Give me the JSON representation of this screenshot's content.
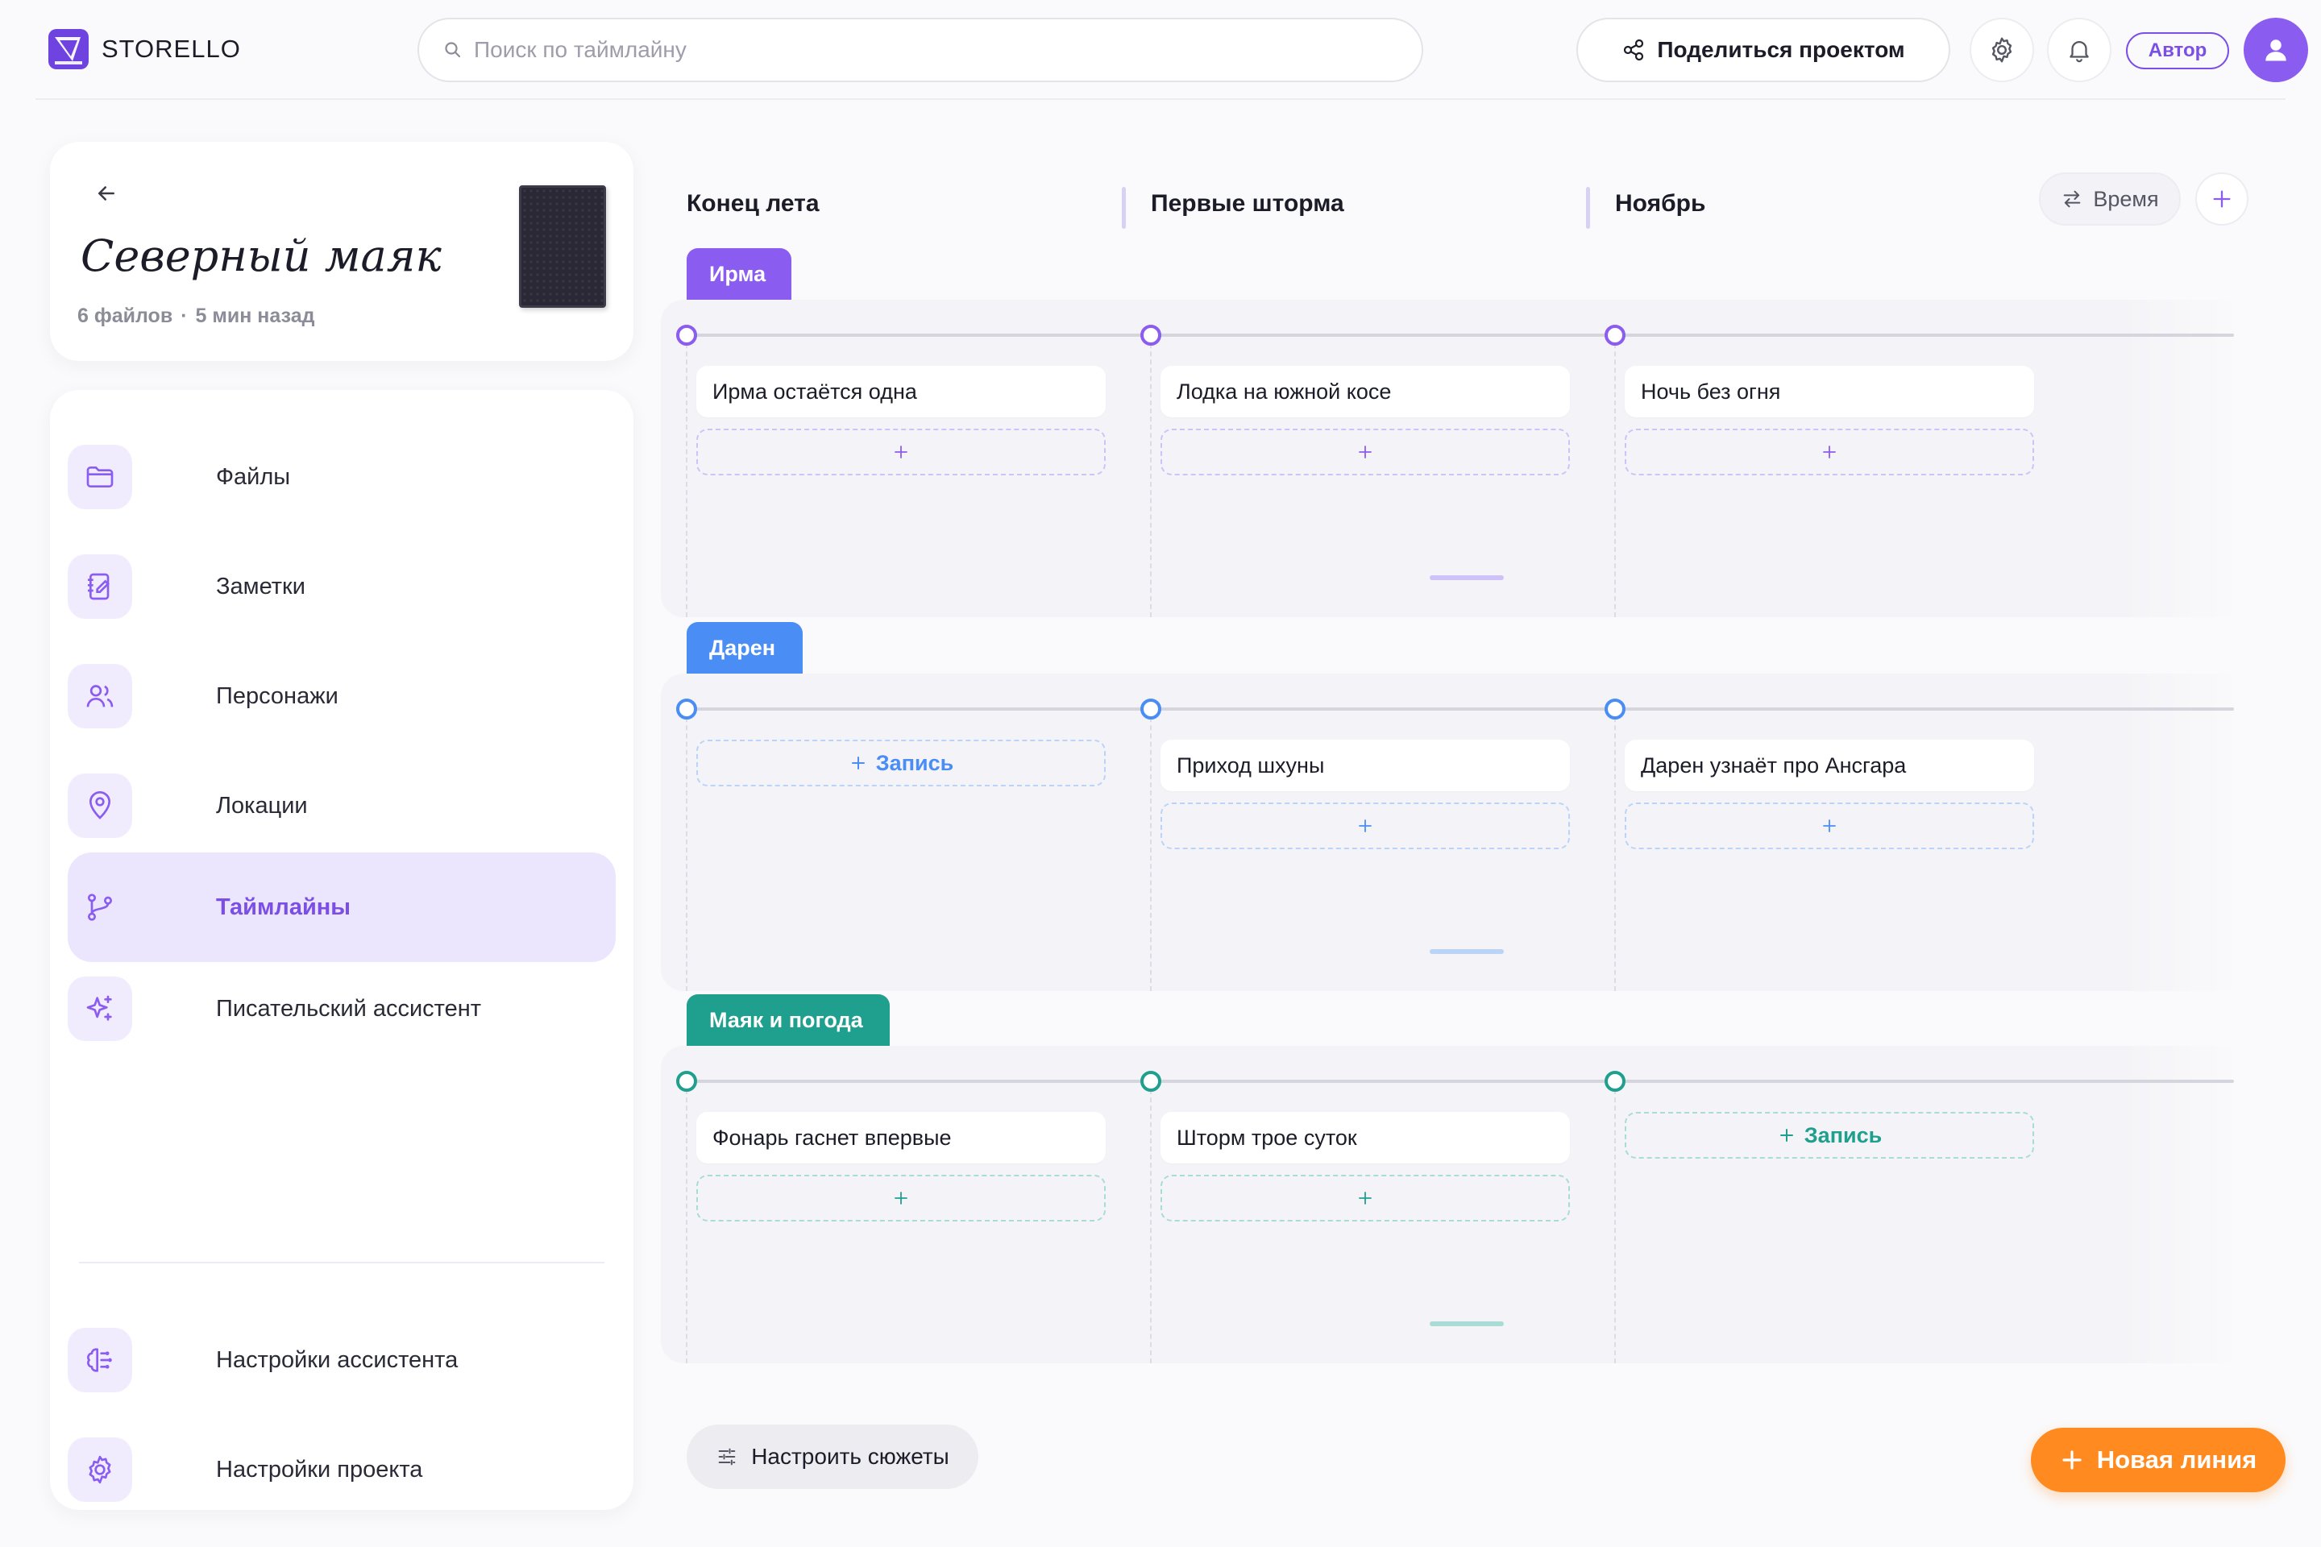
{
  "header": {
    "brand": "STORELLO",
    "search_placeholder": "Поиск по таймлайну",
    "share_label": "Поделиться проектом",
    "role_badge": "Автор"
  },
  "project": {
    "title": "Северный маяк",
    "files": "6 файлов",
    "separator": "·",
    "updated": "5 мин назад"
  },
  "nav": {
    "items": [
      {
        "label": "Файлы",
        "icon": "folder-icon",
        "active": false
      },
      {
        "label": "Заметки",
        "icon": "notebook-icon",
        "active": false
      },
      {
        "label": "Персонажи",
        "icon": "users-icon",
        "active": false
      },
      {
        "label": "Локации",
        "icon": "map-pin-icon",
        "active": false
      },
      {
        "label": "Таймлайны",
        "icon": "git-branch-icon",
        "active": true
      },
      {
        "label": "Писательский ассистент",
        "icon": "sparkles-icon",
        "active": false
      }
    ],
    "bottom_items": [
      {
        "label": "Настройки ассистента",
        "icon": "brain-icon"
      },
      {
        "label": "Настройки проекта",
        "icon": "gear-icon"
      }
    ]
  },
  "timeline": {
    "columns": [
      "Конец лета",
      "Первые шторма",
      "Ноябрь"
    ],
    "time_button": "Время",
    "lanes": [
      {
        "name": "Ирма",
        "color": "#8a5cf0",
        "slot_border": "#cfc2f8",
        "cells": [
          {
            "event": "Ирма остаётся одна"
          },
          {
            "event": "Лодка на южной косе"
          },
          {
            "event": "Ночь без огня"
          }
        ]
      },
      {
        "name": "Дарен",
        "color": "#4a8df5",
        "slot_border": "#bcd3f8",
        "cells": [
          {
            "event": null,
            "slot_label": "Запись"
          },
          {
            "event": "Приход шхуны"
          },
          {
            "event": "Дарен узнаёт про Ансгара"
          }
        ]
      },
      {
        "name": "Маяк и погода",
        "color": "#1f9f8e",
        "slot_border": "#a9dcd4",
        "cells": [
          {
            "event": "Фонарь гаснет впервые"
          },
          {
            "event": "Шторм трое суток"
          },
          {
            "event": null,
            "slot_label": "Запись"
          }
        ]
      }
    ],
    "configure_label": "Настроить сюжеты",
    "new_line_label": "Новая линия"
  },
  "colors": {
    "accent": "#7b4fe5",
    "orange": "#ff8a1f"
  }
}
